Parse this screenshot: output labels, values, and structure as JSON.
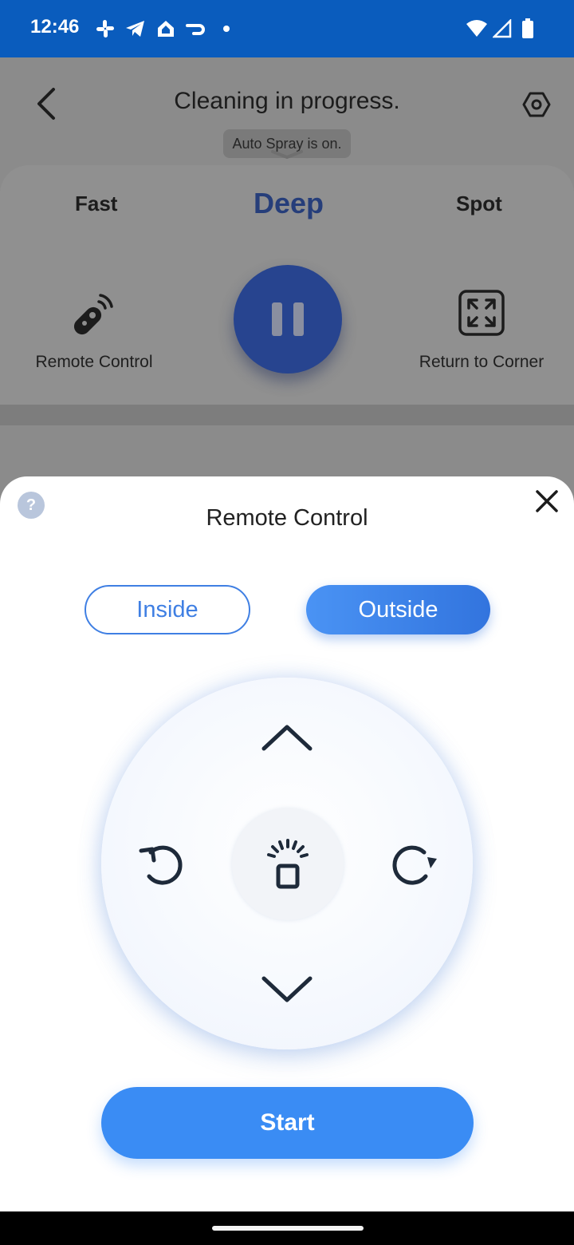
{
  "status_bar": {
    "time": "12:46",
    "left_icons": [
      "slack-icon",
      "telegram-icon",
      "home-icon",
      "flow-icon",
      "dot-icon"
    ],
    "right_icons": [
      "wifi-icon",
      "signal-icon",
      "battery-icon"
    ],
    "color": "#0a5cbd"
  },
  "header": {
    "title": "Cleaning in progress.",
    "status_pill": "Auto Spray is on."
  },
  "modes": {
    "fast": "Fast",
    "deep": "Deep",
    "spot": "Spot",
    "selected": "Deep"
  },
  "actions": {
    "remote_control": "Remote Control",
    "return_to_corner": "Return to Corner"
  },
  "sheet": {
    "title": "Remote Control",
    "help": "?",
    "segments": {
      "inside": "Inside",
      "outside": "Outside",
      "selected": "Outside"
    },
    "start_label": "Start",
    "accent": "#3a8cf4"
  }
}
